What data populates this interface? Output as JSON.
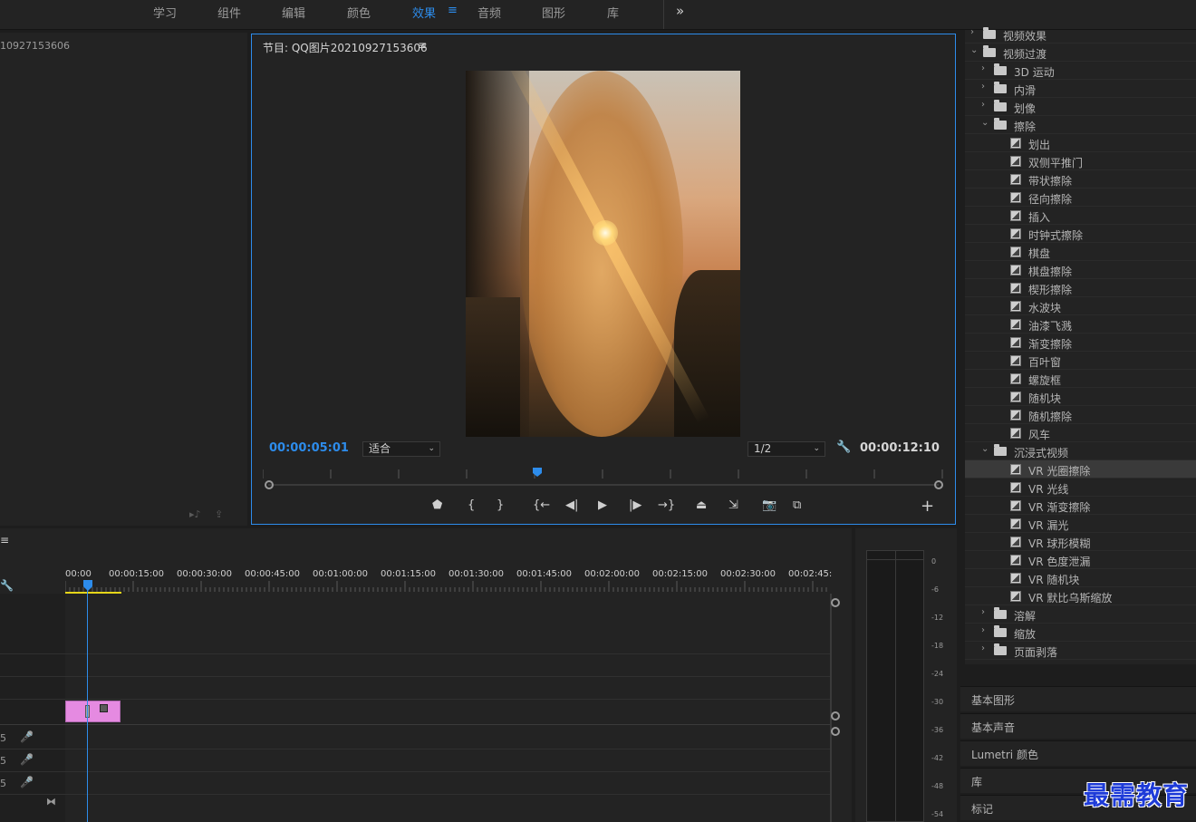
{
  "workspaces": {
    "tabs": [
      {
        "label": "学习",
        "active": false
      },
      {
        "label": "组件",
        "active": false
      },
      {
        "label": "编辑",
        "active": false
      },
      {
        "label": "颜色",
        "active": false
      },
      {
        "label": "效果",
        "active": true
      },
      {
        "label": "音频",
        "active": false
      },
      {
        "label": "图形",
        "active": false
      },
      {
        "label": "库",
        "active": false
      }
    ],
    "menu_glyph": "≡",
    "more_glyph": "»"
  },
  "source": {
    "title": "10927153606",
    "icon_a": "▸♪",
    "icon_b": "⇪"
  },
  "program": {
    "title": "节目: QQ图片20210927153606",
    "menu_glyph": "≡",
    "timecode_current": "00:00:05:01",
    "zoom": "适合",
    "resolution": "1/2",
    "timecode_duration": "00:00:12:10",
    "wrench_glyph": "🔧",
    "add_glyph": "+",
    "transport": {
      "marker": "⬟",
      "mark_in": "{",
      "mark_out": "}",
      "go_in": "{←",
      "step_back": "◀|",
      "play": "▶",
      "step_fwd": "|▶",
      "go_out": "→}",
      "lift": "⏏",
      "extract": "⇲",
      "export_frame": "📷",
      "compare": "⧉"
    }
  },
  "timeline": {
    "menu_glyph": "≡",
    "wrench_glyph": "🔧",
    "ruler": [
      "00:00",
      "00:00:15:00",
      "00:00:30:00",
      "00:00:45:00",
      "00:01:00:00",
      "00:01:15:00",
      "00:01:30:00",
      "00:01:45:00",
      "00:02:00:00",
      "00:02:15:00",
      "00:02:30:00",
      "00:02:45:"
    ],
    "audio_tracks": [
      {
        "num": "5",
        "mic": "🎤"
      },
      {
        "num": "5",
        "mic": "🎤"
      },
      {
        "num": "5",
        "mic": "🎤"
      }
    ],
    "bowtie_glyph": "⧓",
    "clip_color": "#e58ae1"
  },
  "meter": {
    "db_labels": [
      "0",
      "-6",
      "-12",
      "-18",
      "-24",
      "-30",
      "-36",
      "-42",
      "-48",
      "-54"
    ]
  },
  "effects": {
    "rows": [
      {
        "label": "视频效果",
        "type": "folder",
        "indent": 0,
        "chevron": "›"
      },
      {
        "label": "视频过渡",
        "type": "folder",
        "indent": 0,
        "chevron": "⌄"
      },
      {
        "label": "3D 运动",
        "type": "folder",
        "indent": 1,
        "chevron": "›"
      },
      {
        "label": "内滑",
        "type": "folder",
        "indent": 1,
        "chevron": "›"
      },
      {
        "label": "划像",
        "type": "folder",
        "indent": 1,
        "chevron": "›"
      },
      {
        "label": "擦除",
        "type": "folder",
        "indent": 1,
        "chevron": "⌄"
      },
      {
        "label": "划出",
        "type": "effect",
        "indent": 2
      },
      {
        "label": "双侧平推门",
        "type": "effect",
        "indent": 2
      },
      {
        "label": "带状擦除",
        "type": "effect",
        "indent": 2
      },
      {
        "label": "径向擦除",
        "type": "effect",
        "indent": 2
      },
      {
        "label": "插入",
        "type": "effect",
        "indent": 2
      },
      {
        "label": "时钟式擦除",
        "type": "effect",
        "indent": 2
      },
      {
        "label": "棋盘",
        "type": "effect",
        "indent": 2
      },
      {
        "label": "棋盘擦除",
        "type": "effect",
        "indent": 2
      },
      {
        "label": "楔形擦除",
        "type": "effect",
        "indent": 2
      },
      {
        "label": "水波块",
        "type": "effect",
        "indent": 2
      },
      {
        "label": "油漆飞溅",
        "type": "effect",
        "indent": 2
      },
      {
        "label": "渐变擦除",
        "type": "effect",
        "indent": 2
      },
      {
        "label": "百叶窗",
        "type": "effect",
        "indent": 2
      },
      {
        "label": "螺旋框",
        "type": "effect",
        "indent": 2
      },
      {
        "label": "随机块",
        "type": "effect",
        "indent": 2
      },
      {
        "label": "随机擦除",
        "type": "effect",
        "indent": 2
      },
      {
        "label": "风车",
        "type": "effect",
        "indent": 2
      },
      {
        "label": "沉浸式视频",
        "type": "folder",
        "indent": 1,
        "chevron": "⌄"
      },
      {
        "label": "VR 光圈擦除",
        "type": "effect",
        "indent": 2,
        "selected": true
      },
      {
        "label": "VR 光线",
        "type": "effect",
        "indent": 2
      },
      {
        "label": "VR 渐变擦除",
        "type": "effect",
        "indent": 2
      },
      {
        "label": "VR 漏光",
        "type": "effect",
        "indent": 2
      },
      {
        "label": "VR 球形模糊",
        "type": "effect",
        "indent": 2
      },
      {
        "label": "VR 色度泄漏",
        "type": "effect",
        "indent": 2
      },
      {
        "label": "VR 随机块",
        "type": "effect",
        "indent": 2
      },
      {
        "label": "VR 默比乌斯缩放",
        "type": "effect",
        "indent": 2
      },
      {
        "label": "溶解",
        "type": "folder",
        "indent": 1,
        "chevron": "›"
      },
      {
        "label": "缩放",
        "type": "folder",
        "indent": 1,
        "chevron": "›"
      },
      {
        "label": "页面剥落",
        "type": "folder",
        "indent": 1,
        "chevron": "›"
      }
    ]
  },
  "side_panels": [
    "基本图形",
    "基本声音",
    "Lumetri 颜色",
    "库",
    "标记"
  ],
  "watermark": "最需教育",
  "colors": {
    "accent": "#2d8ceb",
    "inout": "#e6d619"
  }
}
